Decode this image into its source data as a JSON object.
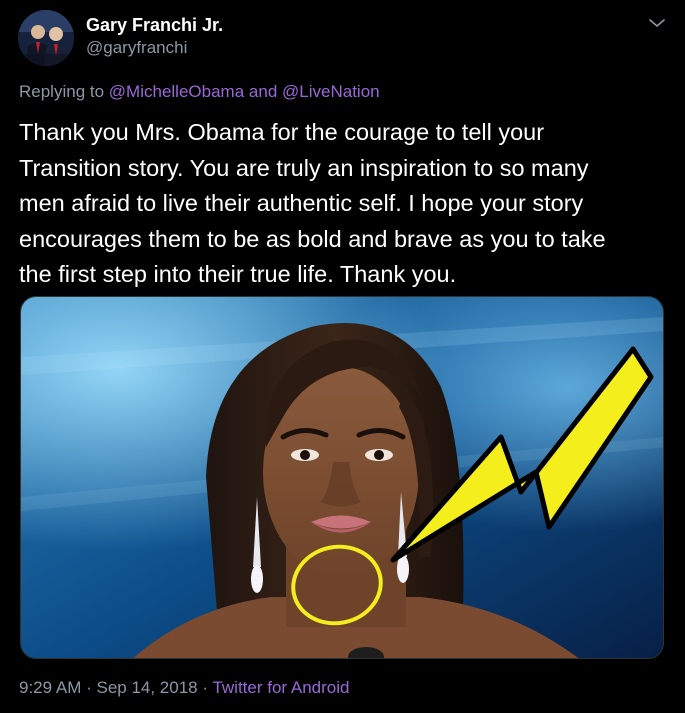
{
  "author": {
    "display_name": "Gary Franchi Jr.",
    "handle": "@garyfranchi"
  },
  "icons": {
    "avatar": "profile-photo",
    "menu": "chevron-down-icon"
  },
  "reply": {
    "prefix": "Replying to",
    "mention_1": "@MichelleObama",
    "joiner": "and",
    "mention_2": "@LiveNation"
  },
  "tweet_text": {
    "line_1": "Thank you Mrs. Obama for the courage to tell your",
    "line_2": "Transition story. You are truly an inspiration to so many",
    "line_3": "men afraid to live their authentic self. I hope your story",
    "line_4": "encourages them to be as bold and brave as you to take",
    "line_5": "the first step into their true life. Thank you."
  },
  "media": {
    "annotation_color": "#f4ee1d",
    "annotation_shapes": [
      "arrow",
      "circle"
    ]
  },
  "meta": {
    "time": "9:29 AM",
    "separator_1": " · ",
    "date": "Sep 14, 2018",
    "separator_2": " · ",
    "source": "Twitter for Android"
  },
  "colors": {
    "background": "#000000",
    "text": "#ffffff",
    "muted": "#8b98a5",
    "link": "#9a67d8"
  }
}
